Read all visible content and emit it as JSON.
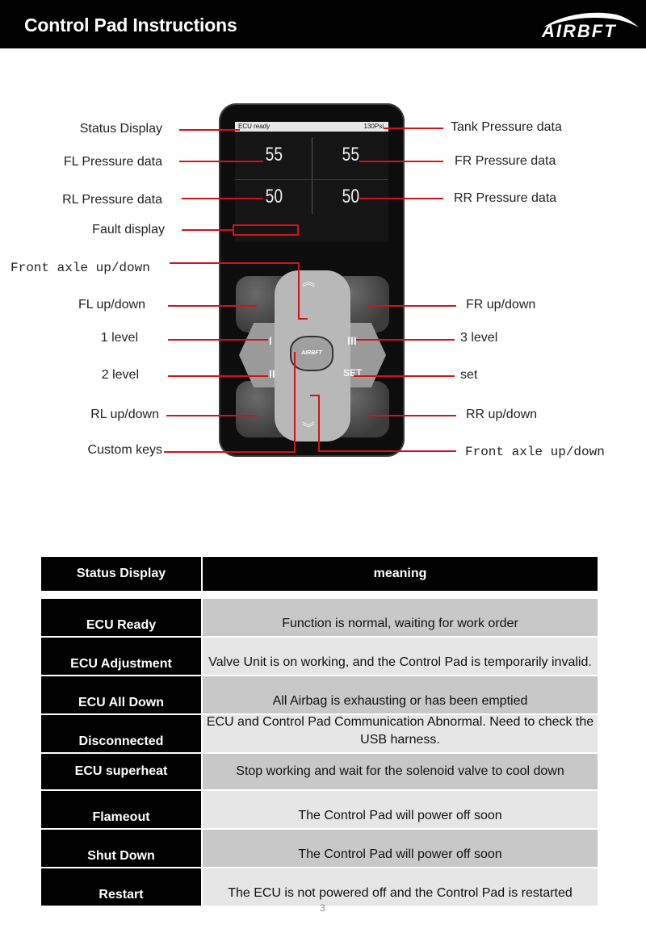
{
  "header": {
    "title": "Control Pad Instructions",
    "brand": "AIRBFT"
  },
  "device": {
    "status_text": "ECU ready",
    "tank_pressure": "130Psi",
    "fl_pressure": "55",
    "fr_pressure": "55",
    "rl_pressure": "50",
    "rr_pressure": "50",
    "key_level1": "I",
    "key_level2": "II",
    "key_level3": "III",
    "key_set": "SET",
    "center_logo": "AIRBFT",
    "chevron_up": "︽",
    "chevron_down": "︾"
  },
  "callouts": {
    "left": [
      "Status Display",
      "FL Pressure data",
      "RL Pressure data",
      "Fault display",
      "Front axle up/down",
      "FL up/down",
      "1 level",
      "2 level",
      "RL up/down",
      "Custom keys"
    ],
    "right": [
      "Tank Pressure data",
      "FR Pressure data",
      "RR Pressure data",
      "FR up/down",
      "3 level",
      "set",
      "RR up/down",
      "Front axle up/down"
    ]
  },
  "table": {
    "headers": [
      "Status Display",
      "meaning"
    ],
    "rows": [
      {
        "status": "ECU Ready",
        "meaning": "Function is normal, waiting for work order"
      },
      {
        "status": "ECU Adjustment",
        "meaning": "Valve Unit  is on working, and the Control Pad   is temporarily invalid."
      },
      {
        "status": "ECU All Down",
        "meaning": "All Airbag is exhausting or has been emptied"
      },
      {
        "status": "Disconnected",
        "meaning": "ECU and Control Pad Communication Abnormal. Need to check the USB harness."
      },
      {
        "status": "ECU superheat",
        "meaning": "Stop working and wait for the solenoid valve to cool down"
      },
      {
        "status": "Flameout",
        "meaning": "The Control Pad will power off soon"
      },
      {
        "status": "Shut Down",
        "meaning": "The Control Pad will power off soon"
      },
      {
        "status": "Restart",
        "meaning": "The ECU is not powered off and the Control Pad is restarted"
      }
    ]
  },
  "footer": {
    "page_number": "3"
  }
}
